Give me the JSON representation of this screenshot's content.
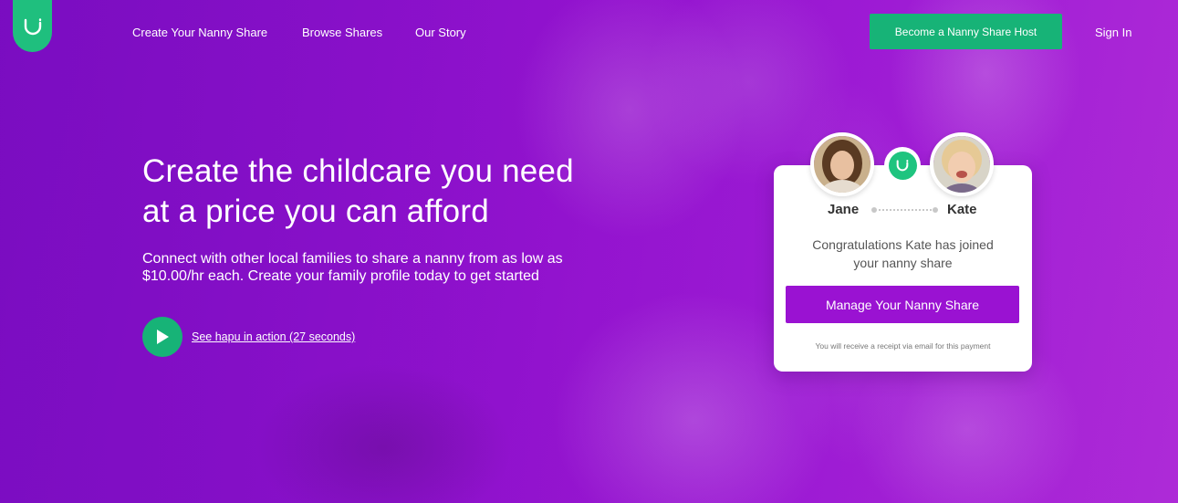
{
  "nav": {
    "links": [
      "Create Your Nanny Share",
      "Browse Shares",
      "Our Story"
    ],
    "host_button": "Become a Nanny Share Host",
    "sign_in": "Sign In"
  },
  "hero": {
    "title_line1": "Create the childcare you need",
    "title_line2": "at a price you can afford",
    "subtitle_line1": "Connect with other local families to share a nanny from as low as",
    "subtitle_line2": "$10.00/hr each. Create your family profile today to get started",
    "video_link": "See hapu in action (27 seconds)"
  },
  "card": {
    "person_left": "Jane",
    "person_right": "Kate",
    "message_line1": "Congratulations Kate has joined",
    "message_line2": "your nanny share",
    "button": "Manage Your Nanny Share",
    "receipt_note": "You will receive a receipt via email for this payment"
  },
  "colors": {
    "brand_green": "#1fbf7e",
    "brand_purple": "#9a12d2",
    "hero_purple": "#8a12c8"
  },
  "icons": [
    "hapu-logo-icon",
    "play-icon",
    "hapu-mini-logo-icon"
  ]
}
